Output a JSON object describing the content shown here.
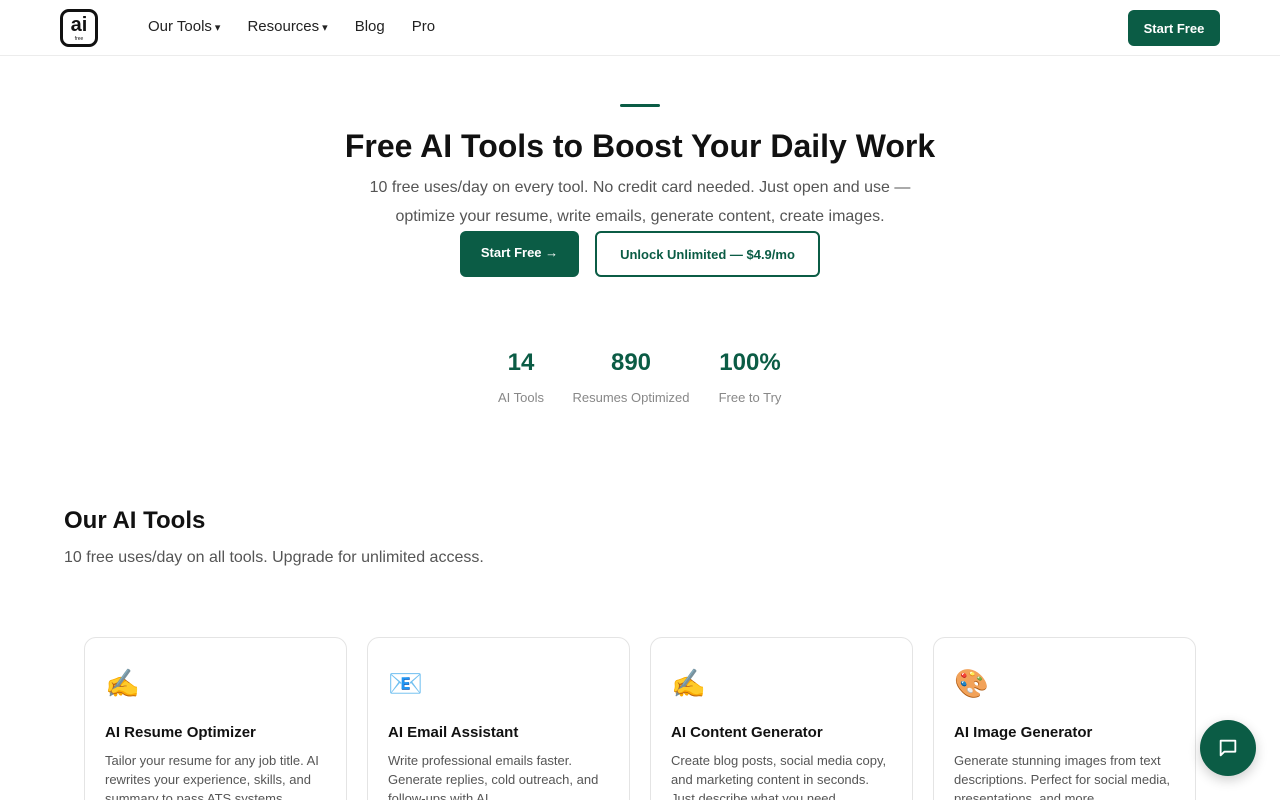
{
  "header": {
    "logo_text": "ai",
    "logo_sub": "free",
    "nav": [
      {
        "label": "Our Tools",
        "caret": "▾"
      },
      {
        "label": "Resources",
        "caret": "▾"
      },
      {
        "label": "Blog",
        "caret": ""
      },
      {
        "label": "Pro",
        "caret": ""
      }
    ],
    "cta_label": "Start Free"
  },
  "hero": {
    "title": "Free AI Tools to Boost Your Daily Work",
    "subtitle": "10 free uses/day on every tool. No credit card needed. Just open and use — optimize your resume, write emails, generate content, create images.",
    "primary_label": "Start Free →",
    "secondary_label": "Unlock Unlimited — $4.9/mo"
  },
  "stats": [
    {
      "value": "14",
      "label": "AI Tools"
    },
    {
      "value": "890",
      "label": "Resumes Optimized"
    },
    {
      "value": "100%",
      "label": "Free to Try"
    }
  ],
  "tools_section": {
    "title": "Our AI Tools",
    "subtitle": "10 free uses/day on all tools. Upgrade for unlimited access."
  },
  "cards": [
    {
      "icon": "✍️",
      "title": "AI Resume Optimizer",
      "desc": "Tailor your resume for any job title. AI rewrites your experience, skills, and summary to pass ATS systems."
    },
    {
      "icon": "📧",
      "title": "AI Email Assistant",
      "desc": "Write professional emails faster. Generate replies, cold outreach, and follow-ups with AI."
    },
    {
      "icon": "✍️",
      "title": "AI Content Generator",
      "desc": "Create blog posts, social media copy, and marketing content in seconds. Just describe what you need."
    },
    {
      "icon": "🎨",
      "title": "AI Image Generator",
      "desc": "Generate stunning images from text descriptions. Perfect for social media, presentations, and more."
    }
  ],
  "colors": {
    "brand": "#0b5c45"
  }
}
